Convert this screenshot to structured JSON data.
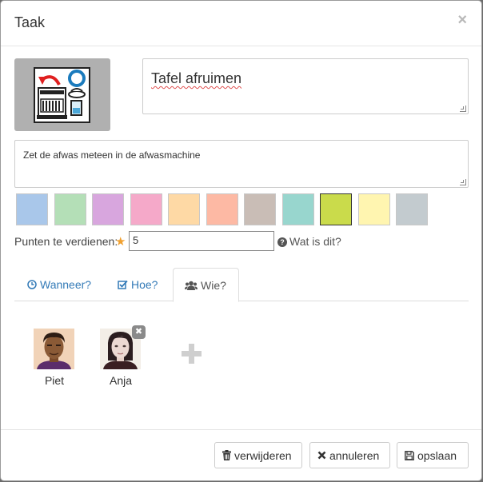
{
  "dialog": {
    "title": "Taak",
    "close": "×"
  },
  "task": {
    "title": "Tafel afruimen",
    "description": "Zet de afwas meteen in de afwasmachine",
    "picto_icon": "dishwasher-icon"
  },
  "colors": [
    "#a9c7ea",
    "#b4dfb7",
    "#d8a6de",
    "#f5a9c9",
    "#fed9a5",
    "#fdb9a4",
    "#c9bdb6",
    "#98d6ce",
    "#cadb4b",
    "#fff5b0",
    "#c3cbcf"
  ],
  "selected_color_index": 8,
  "points": {
    "label": "Punten te verdienen:",
    "value": "5",
    "help": "Wat is dit?"
  },
  "tabs": [
    {
      "label": "Wanneer?",
      "icon": "clock-icon"
    },
    {
      "label": "Hoe?",
      "icon": "checkbox-icon"
    },
    {
      "label": "Wie?",
      "icon": "users-icon"
    }
  ],
  "people": [
    {
      "name": "Piet"
    },
    {
      "name": "Anja"
    }
  ],
  "buttons": {
    "delete": "verwijderen",
    "cancel": "annuleren",
    "save": "opslaan"
  }
}
